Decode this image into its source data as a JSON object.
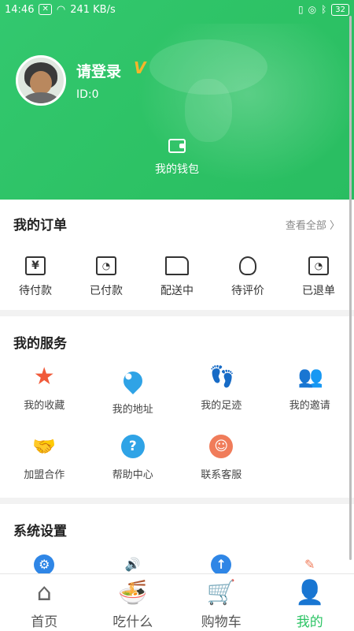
{
  "status_bar": {
    "time": "14:46",
    "speed": "241 KB/s",
    "battery": "32"
  },
  "profile": {
    "login_prompt": "请登录",
    "vip_mark": "V",
    "id_text": "ID:0"
  },
  "wallet": {
    "label": "我的钱包",
    "icon": "wallet-icon"
  },
  "orders": {
    "title": "我的订单",
    "view_all": "查看全部 〉",
    "items": [
      {
        "label": "待付款",
        "icon": "payment-pending-icon",
        "glyph": "¥"
      },
      {
        "label": "已付款",
        "icon": "paid-icon",
        "glyph": "◔"
      },
      {
        "label": "配送中",
        "icon": "truck-icon",
        "glyph": ""
      },
      {
        "label": "待评价",
        "icon": "flower-icon",
        "glyph": ""
      },
      {
        "label": "已退单",
        "icon": "refund-icon",
        "glyph": "◔"
      }
    ]
  },
  "services": {
    "title": "我的服务",
    "items": [
      {
        "label": "我的收藏",
        "icon": "star-icon",
        "glyph": "★"
      },
      {
        "label": "我的地址",
        "icon": "location-pin-icon",
        "glyph": ""
      },
      {
        "label": "我的足迹",
        "icon": "footprint-icon",
        "glyph": "👣"
      },
      {
        "label": "我的邀请",
        "icon": "users-icon",
        "glyph": "👥"
      },
      {
        "label": "加盟合作",
        "icon": "handshake-icon",
        "glyph": "🤝"
      },
      {
        "label": "帮助中心",
        "icon": "help-icon",
        "glyph": "?"
      },
      {
        "label": "联系客服",
        "icon": "customer-service-icon",
        "glyph": "☺"
      }
    ]
  },
  "settings": {
    "title": "系统设置",
    "icons": [
      {
        "icon": "settings-gear-icon",
        "glyph": "⚙",
        "color": "#2f86e6"
      },
      {
        "icon": "speaker-icon",
        "glyph": "🔊",
        "color": "#f07c5a"
      },
      {
        "icon": "upload-icon",
        "glyph": "↑",
        "color": "#2f86e6"
      },
      {
        "icon": "pencil-icon",
        "glyph": "✎",
        "color": "#f07c5a"
      }
    ]
  },
  "tabbar": {
    "items": [
      {
        "label": "首页",
        "icon": "home-icon",
        "glyph": "⌂",
        "active": false
      },
      {
        "label": "吃什么",
        "icon": "noodle-bowl-icon",
        "glyph": "🍜",
        "active": false
      },
      {
        "label": "购物车",
        "icon": "cart-icon",
        "glyph": "🛒",
        "active": false
      },
      {
        "label": "我的",
        "icon": "profile-icon",
        "glyph": "👤",
        "active": true
      }
    ]
  },
  "colors": {
    "brand_green": "#2cc464",
    "text_dark": "#222222",
    "muted": "#888888"
  }
}
